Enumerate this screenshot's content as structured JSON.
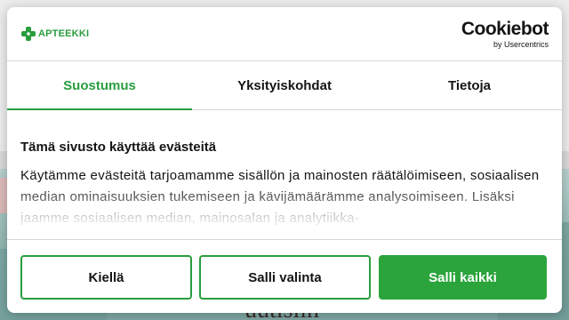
{
  "brand": {
    "logo_text": "APTEEKKI",
    "cookiebot_name": "Cookiebot",
    "cookiebot_sub": "by Usercentrics"
  },
  "tabs": [
    {
      "label": "Suostumus",
      "active": true
    },
    {
      "label": "Yksityiskohdat",
      "active": false
    },
    {
      "label": "Tietoja",
      "active": false
    }
  ],
  "content": {
    "title": "Tämä sivusto käyttää evästeitä",
    "body": "Käytämme evästeitä tarjoamamme sisällön ja mainosten räätälöimiseen, sosiaalisen median ominaisuuksien tukemiseen ja kävijämäärämme analysoimiseen. Lisäksi jaamme sosiaalisen median, mainosalan ja analytiikka-"
  },
  "buttons": {
    "deny": "Kiellä",
    "allow_selection": "Salli valinta",
    "allow_all": "Salli kaikki"
  },
  "background": {
    "title_fragment": "uutisiin"
  },
  "colors": {
    "accent": "#2a9d3e",
    "button_primary": "#2aa43b",
    "text": "#141414"
  }
}
